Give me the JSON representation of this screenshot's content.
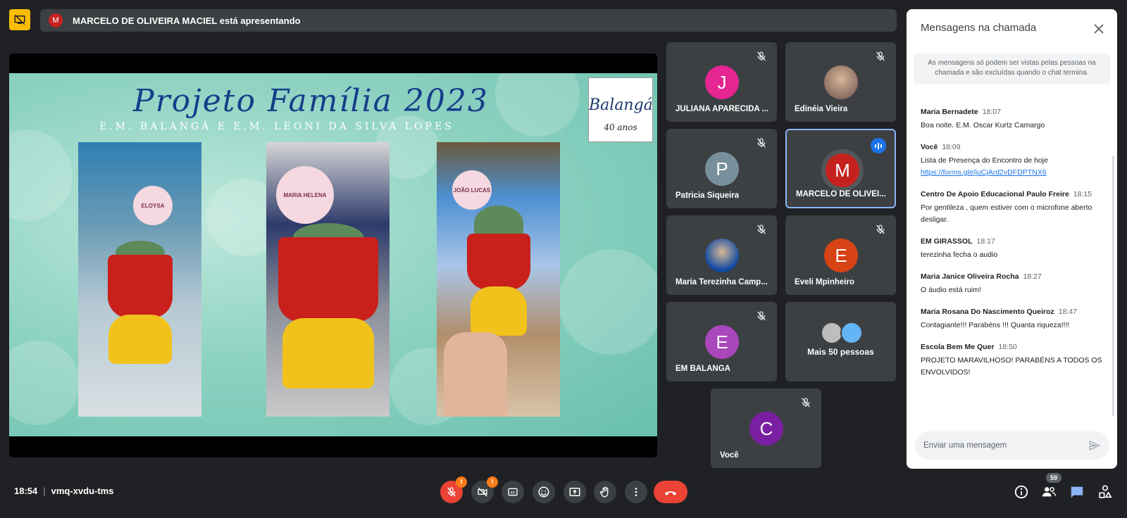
{
  "banner": {
    "avatar_letter": "M",
    "text": "MARCELO DE OLIVEIRA MACIEL está apresentando"
  },
  "slide": {
    "title": "Projeto Família 2023",
    "subtitle": "E.M. BALANGÁ E E.M. LEONI DA SILVA LOPES",
    "logo_name": "Balangá",
    "logo_years": "40 anos",
    "photo_tags": [
      "ELOYSA",
      "MARIA HELENA",
      "JOÃO LUCAS"
    ]
  },
  "participants": [
    {
      "letter": "J",
      "name": "JULIANA APARECIDA ...",
      "color": "#e52592",
      "muted": true
    },
    {
      "letter": "",
      "name": "Edinéia Vieira",
      "color": "#8d6e63",
      "muted": true,
      "photo": true
    },
    {
      "letter": "P",
      "name": "Patricia Siqueira",
      "color": "#78909c",
      "muted": true
    },
    {
      "letter": "M",
      "name": "MARCELO DE OLIVEI...",
      "color": "#c5221f",
      "muted": false,
      "speaking": true
    },
    {
      "letter": "",
      "name": "Maria Terezinha Camp...",
      "color": "#0d47a1",
      "muted": true,
      "photo": true
    },
    {
      "letter": "E",
      "name": "Eveli Mpinheiro",
      "color": "#d84315",
      "muted": true
    },
    {
      "letter": "E",
      "name": "EM BALANGA",
      "color": "#ab47bc",
      "muted": true
    },
    {
      "letter": "",
      "name": "Mais 50 pessoas",
      "color": "#3c4043",
      "muted": false,
      "more": true
    },
    {
      "letter": "C",
      "name": "Você",
      "color": "#7b1fa2",
      "muted": true
    }
  ],
  "chat": {
    "title": "Mensagens na chamada",
    "notice": "As mensagens só podem ser vistas pelas pessoas na chamada e são excluídas quando o chat termina.",
    "messages": [
      {
        "sender": "Maria Bernadete",
        "time": "18:07",
        "lines": [
          "Boa noite. E.M. Oscar Kurtz Camargo"
        ]
      },
      {
        "sender": "Você",
        "time": "18:09",
        "lines": [
          "Lista de Presença do Encontro de hoje"
        ],
        "link": "https://forms.gle/juCjArd2vDFDPTNX6"
      },
      {
        "sender": "Centro De Apoio Educacional Paulo Freire",
        "time": "18:15",
        "lines": [
          "Por gentileza , quem estiver com o microfone aberto",
          "desligar."
        ]
      },
      {
        "sender": "EM GIRASSOL",
        "time": "18:17",
        "lines": [
          "terezinha fecha o audio"
        ]
      },
      {
        "sender": "Maria Janice Oliveira Rocha",
        "time": "18:27",
        "lines": [
          "O áudio está ruim!"
        ]
      },
      {
        "sender": "Maria Rosana Do Nascimento Queiroz",
        "time": "18:47",
        "lines": [
          "Contagiante!!! Parabéns !!! Quanta riqueza!!!!"
        ]
      },
      {
        "sender": "Escola Bem Me Quer",
        "time": "18:50",
        "lines": [
          "PROJETO MARAVILHOSO! PARABÉNS A TODOS OS",
          "ENVOLVIDOS!"
        ]
      }
    ],
    "input_placeholder": "Enviar uma mensagem"
  },
  "bottom": {
    "time": "18:54",
    "meeting_code": "vmq-xvdu-tms",
    "warn_badge": "!",
    "people_count": "59"
  }
}
